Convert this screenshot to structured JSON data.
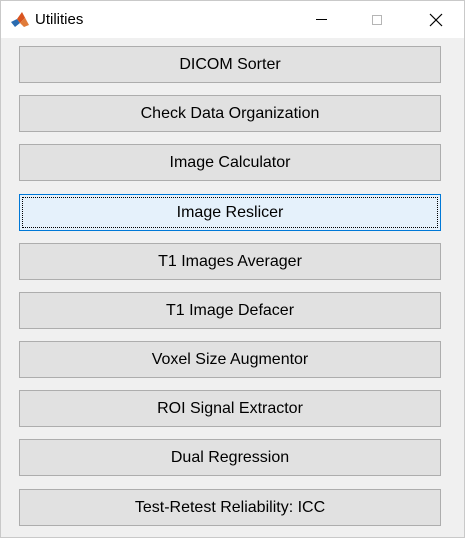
{
  "window": {
    "title": "Utilities",
    "app_icon": "matlab-logo-icon",
    "controls": {
      "minimize": "minimize-icon",
      "maximize": "maximize-icon",
      "close": "close-icon"
    }
  },
  "buttons": [
    {
      "label": "DICOM Sorter",
      "state": "normal"
    },
    {
      "label": "Check Data Organization",
      "state": "normal"
    },
    {
      "label": "Image Calculator",
      "state": "normal"
    },
    {
      "label": "Image Reslicer",
      "state": "focused"
    },
    {
      "label": "T1 Images Averager",
      "state": "normal"
    },
    {
      "label": "T1 Image Defacer",
      "state": "normal"
    },
    {
      "label": "Voxel Size Augmentor",
      "state": "normal"
    },
    {
      "label": "ROI Signal Extractor",
      "state": "normal"
    },
    {
      "label": "Dual Regression",
      "state": "normal"
    },
    {
      "label": "Test-Retest Reliability: ICC",
      "state": "normal"
    }
  ],
  "colors": {
    "window_bg": "#f0f0f0",
    "button_bg": "#e1e1e1",
    "button_border": "#adadad",
    "focus_bg": "#e5f1fb",
    "focus_border": "#0078d7"
  }
}
